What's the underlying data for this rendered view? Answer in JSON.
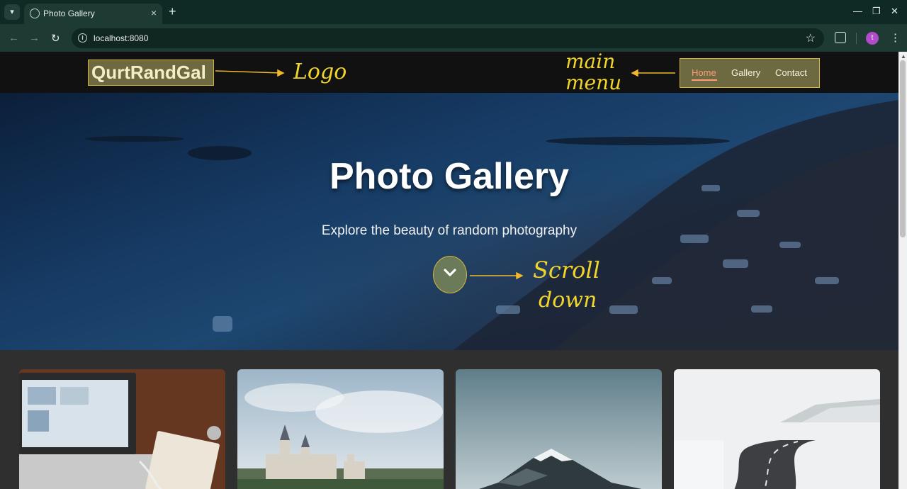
{
  "browser": {
    "tab_title": "Photo Gallery",
    "tab_close": "×",
    "new_tab": "+",
    "url": "localhost:8080",
    "profile_initial": "t",
    "icons": [
      "tab-search-icon",
      "globe-icon",
      "close-icon",
      "back-icon",
      "forward-icon",
      "reload-icon",
      "info-icon",
      "star-icon",
      "extensions-icon",
      "kebab-menu-icon",
      "minimize-icon",
      "restore-icon"
    ]
  },
  "site": {
    "logo": "QurtRandGal",
    "menu": [
      {
        "label": "Home",
        "active": true
      },
      {
        "label": "Gallery",
        "active": false
      },
      {
        "label": "Contact",
        "active": false
      }
    ]
  },
  "hero": {
    "title": "Photo Gallery",
    "subtitle": "Explore the beauty of random photography",
    "scroll_icon": "chevron-down-icon"
  },
  "gallery": {
    "cards": [
      {
        "subject": "laptop-desk-photo"
      },
      {
        "subject": "castle-photo"
      },
      {
        "subject": "mountain-photo"
      },
      {
        "subject": "snowy-road-photo"
      }
    ]
  },
  "annotations": {
    "logo_note": "Logo",
    "menu_note_line1": "main",
    "menu_note_line2": "menu",
    "scroll_note_line1": "Scroll",
    "scroll_note_line2": "down"
  },
  "colors": {
    "annotation": "#f1d52b",
    "highlight_border": "#d4b53a",
    "active_link": "#ff9d78"
  }
}
